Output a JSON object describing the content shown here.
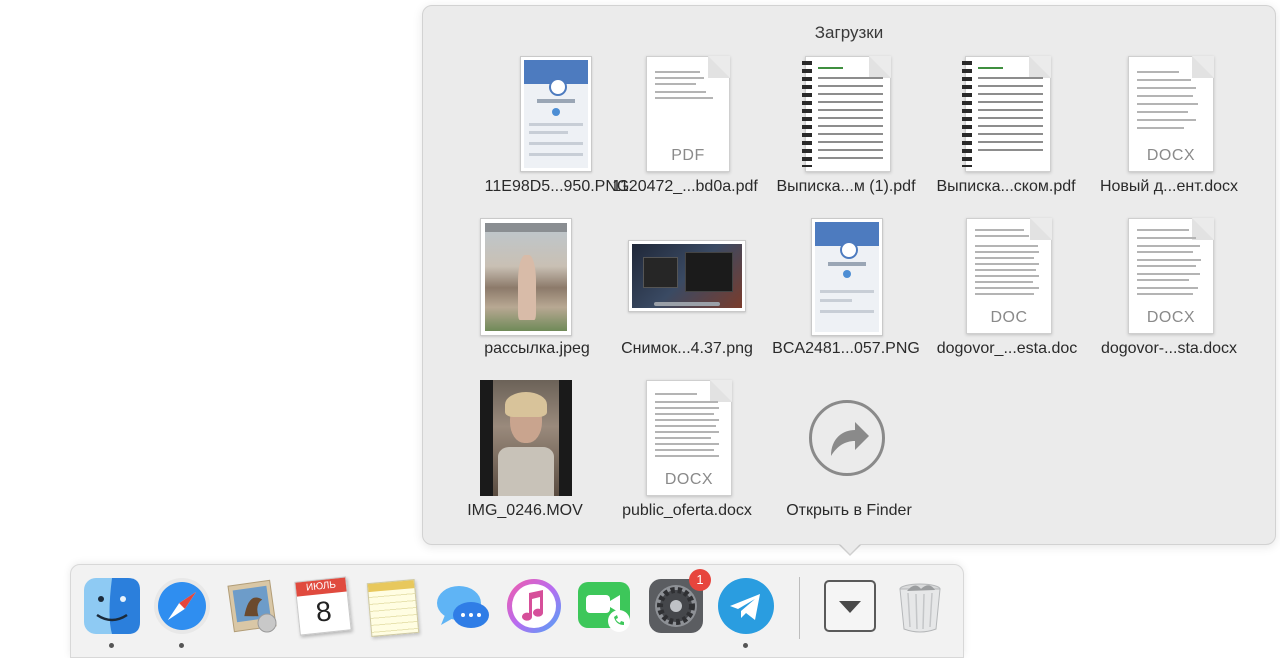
{
  "stack": {
    "title": "Загрузки",
    "items": [
      {
        "label": "11E98D5...950.PNG",
        "type": "image",
        "icon": "phone-screenshot-thumbnail"
      },
      {
        "label": "1120472_...bd0a.pdf",
        "type": "pdf",
        "ext": "PDF",
        "icon": "pdf-document-icon"
      },
      {
        "label": "Выписка...м (1).pdf",
        "type": "pdf",
        "icon": "pdf-spiral-statement-icon"
      },
      {
        "label": "Выписка...ском.pdf",
        "type": "pdf",
        "icon": "pdf-spiral-statement-icon"
      },
      {
        "label": "Новый д...ент.docx",
        "type": "docx",
        "ext": "DOCX",
        "icon": "docx-document-icon"
      },
      {
        "label": "рассылка.jpeg",
        "type": "image",
        "icon": "photo-thumbnail"
      },
      {
        "label": "Снимок...4.37.png",
        "type": "image",
        "icon": "desktop-screenshot-thumbnail"
      },
      {
        "label": "BCA2481...057.PNG",
        "type": "image",
        "icon": "phone-screenshot-thumbnail"
      },
      {
        "label": "dogovor_...esta.doc",
        "type": "doc",
        "ext": "DOC",
        "icon": "doc-document-icon"
      },
      {
        "label": "dogovor-...sta.docx",
        "type": "docx",
        "ext": "DOCX",
        "icon": "docx-document-icon"
      },
      {
        "label": "IMG_0246.MOV",
        "type": "video",
        "icon": "video-thumbnail"
      },
      {
        "label": "public_oferta.docx",
        "type": "docx",
        "ext": "DOCX",
        "icon": "docx-document-icon"
      },
      {
        "label": "Открыть в Finder",
        "type": "action",
        "icon": "open-in-finder-arrow-icon"
      }
    ]
  },
  "dock": {
    "apps": [
      {
        "name": "finder",
        "icon": "finder-icon",
        "running": true
      },
      {
        "name": "safari",
        "icon": "safari-icon",
        "running": true
      },
      {
        "name": "mail",
        "icon": "mail-icon",
        "running": false
      },
      {
        "name": "calendar",
        "icon": "calendar-icon",
        "running": false,
        "month": "ИЮЛЬ",
        "day": "8"
      },
      {
        "name": "notes",
        "icon": "notes-icon",
        "running": false
      },
      {
        "name": "messages",
        "icon": "messages-icon",
        "running": false
      },
      {
        "name": "itunes",
        "icon": "itunes-icon",
        "running": false
      },
      {
        "name": "facetime",
        "icon": "facetime-icon",
        "running": false
      },
      {
        "name": "system-preferences",
        "icon": "gear-icon",
        "running": false,
        "badge": "1"
      },
      {
        "name": "telegram",
        "icon": "telegram-icon",
        "running": true
      }
    ],
    "downloads_stack_icon": "downloads-arrow-icon",
    "trash_icon": "trash-icon"
  },
  "colors": {
    "popover_bg": "#ebebeb",
    "dock_bg": "#f2f2f2",
    "badge": "#e7453d",
    "accent_blue": "#2a8ae6"
  }
}
